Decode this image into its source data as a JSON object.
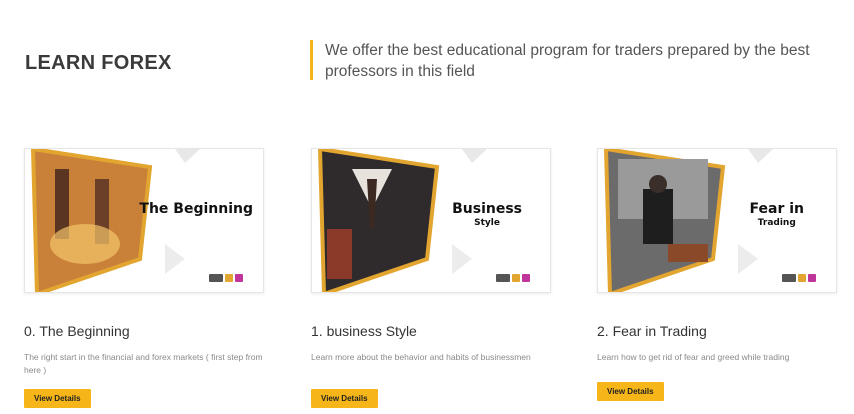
{
  "header": {
    "title": "LEARN FOREX",
    "tagline": "We offer the best educational program for traders prepared by the best professors in this field"
  },
  "colors": {
    "accent": "#f2b51a",
    "button": "#f6b619"
  },
  "cards": [
    {
      "thumb_main": "The Beginning",
      "thumb_sub": "",
      "title": "0. The Beginning",
      "description": "The right start in the financial and forex markets ( first step from here )",
      "button": "View Details"
    },
    {
      "thumb_main": "Business",
      "thumb_sub": "Style",
      "title": "1. business Style",
      "description": "Learn more about the behavior and habits of businessmen",
      "button": "View Details"
    },
    {
      "thumb_main": "Fear in",
      "thumb_sub": "Trading",
      "title": "2. Fear in Trading",
      "description": "Learn how to get rid of fear and greed while trading",
      "button": "View Details"
    }
  ]
}
